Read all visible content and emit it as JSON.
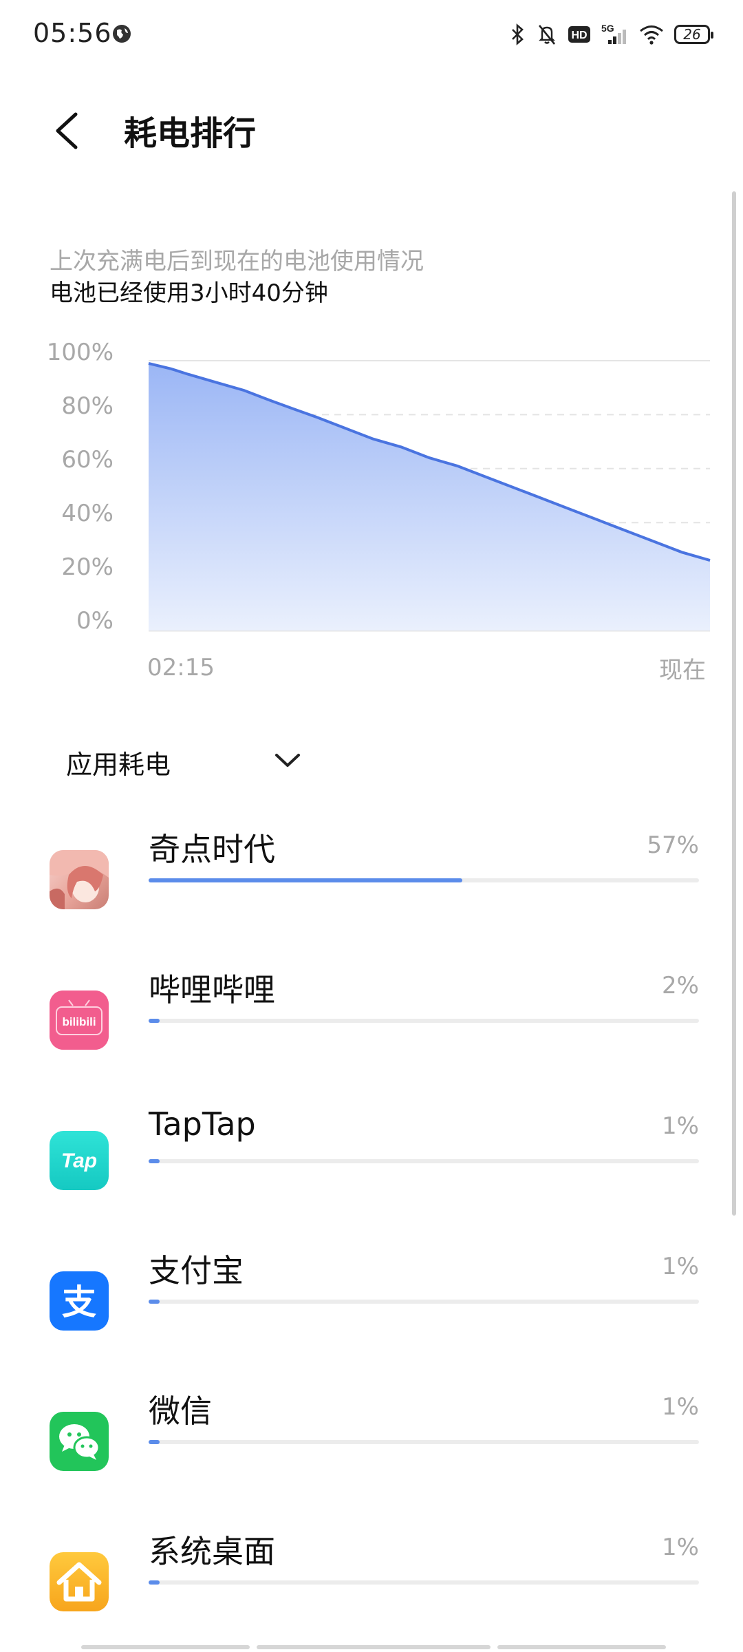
{
  "status_bar": {
    "time": "05:56",
    "battery_level": "26",
    "network": "5G",
    "icons": [
      "globe-icon",
      "bluetooth-icon",
      "mute-icon",
      "hd-icon",
      "signal-icon",
      "wifi-icon",
      "battery-icon"
    ]
  },
  "header": {
    "title": "耗电排行",
    "back_icon": "chevron-left-icon"
  },
  "summary": {
    "line1": "上次充满电后到现在的电池使用情况",
    "line2": "电池已经使用3小时40分钟"
  },
  "chart_data": {
    "type": "area",
    "x_labels": [
      "02:15",
      "现在"
    ],
    "y_ticks": [
      "100%",
      "80%",
      "60%",
      "40%",
      "20%",
      "0%"
    ],
    "ylim": [
      0,
      100
    ],
    "x": [
      0,
      0.04,
      0.07,
      0.12,
      0.17,
      0.22,
      0.26,
      0.3,
      0.35,
      0.4,
      0.45,
      0.5,
      0.55,
      0.6,
      0.65,
      0.7,
      0.75,
      0.8,
      0.85,
      0.9,
      0.95,
      1.0
    ],
    "y": [
      99,
      97,
      95,
      92,
      89,
      85,
      82,
      79,
      75,
      71,
      68,
      64,
      61,
      57,
      53,
      49,
      45,
      41,
      37,
      33,
      29,
      26
    ],
    "grid": true,
    "line_color": "#4a74e0",
    "fill_top": "#9bb6f5",
    "fill_bottom": "#eaf0fd"
  },
  "usage": {
    "section_label": "应用耗电",
    "apps": [
      {
        "name": "奇点时代",
        "percent": "57%",
        "value": 0.57,
        "icon": "anime-girl-icon"
      },
      {
        "name": "哔哩哔哩",
        "percent": "2%",
        "value": 0.02,
        "icon": "bilibili-icon",
        "icon_text": "bilibili"
      },
      {
        "name": "TapTap",
        "percent": "1%",
        "value": 0.01,
        "icon": "taptap-icon",
        "icon_text": "Tap"
      },
      {
        "name": "支付宝",
        "percent": "1%",
        "value": 0.01,
        "icon": "alipay-icon",
        "icon_text": "支"
      },
      {
        "name": "微信",
        "percent": "1%",
        "value": 0.01,
        "icon": "wechat-icon"
      },
      {
        "name": "系统桌面",
        "percent": "1%",
        "value": 0.01,
        "icon": "home-icon"
      }
    ]
  }
}
